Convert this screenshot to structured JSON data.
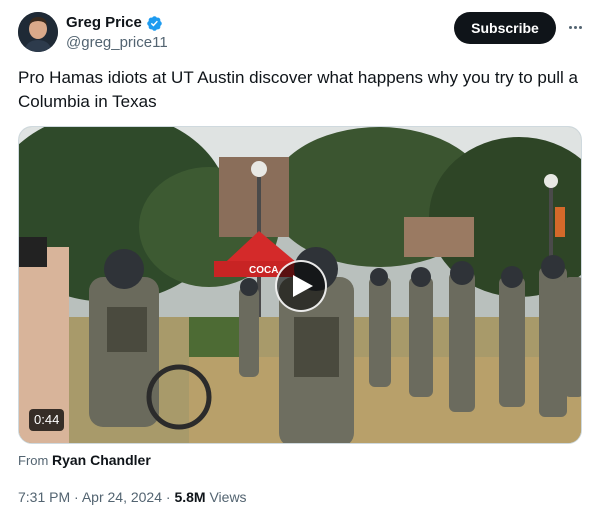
{
  "author": {
    "display_name": "Greg Price",
    "handle": "@greg_price11",
    "verified_icon": "verified-badge-icon"
  },
  "actions": {
    "subscribe_label": "Subscribe",
    "more_icon": "more-options-icon"
  },
  "tweet": {
    "text": "Pro Hamas idiots at UT Austin discover what happens why you try to pull a Columbia in Texas"
  },
  "media": {
    "duration": "0:44",
    "play_icon": "play-icon",
    "tent_text": "COCA"
  },
  "source": {
    "prefix": "From",
    "name": "Ryan Chandler"
  },
  "meta": {
    "time": "7:31 PM",
    "separator": "·",
    "date": "Apr 24, 2024",
    "views_count": "5.8M",
    "views_label": "Views"
  },
  "colors": {
    "verified": "#1d9bf0",
    "text_primary": "#0f1419",
    "text_secondary": "#536471",
    "button_bg": "#0f1419"
  }
}
